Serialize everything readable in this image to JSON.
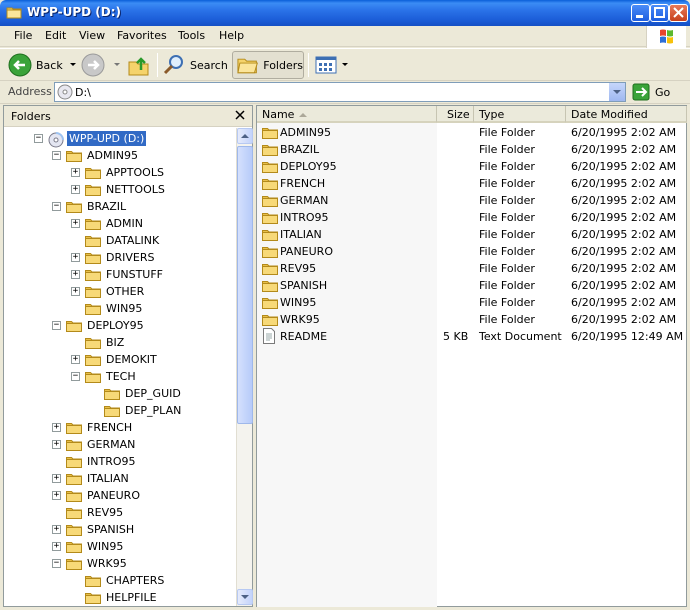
{
  "window": {
    "title": "WPP-UPD (D:)"
  },
  "menu": [
    "File",
    "Edit",
    "View",
    "Favorites",
    "Tools",
    "Help"
  ],
  "toolbar": {
    "back_label": "Back",
    "search_label": "Search",
    "folders_label": "Folders"
  },
  "address": {
    "label": "Address",
    "value": "D:\\",
    "go_label": "Go"
  },
  "folders_pane": {
    "title": "Folders",
    "tree": [
      {
        "label": "WPP-UPD (D:)",
        "level": 0,
        "expander": "-",
        "icon": "cd-drive-icon",
        "selected": true
      },
      {
        "label": "ADMIN95",
        "level": 1,
        "expander": "-"
      },
      {
        "label": "APPTOOLS",
        "level": 2,
        "expander": "+"
      },
      {
        "label": "NETTOOLS",
        "level": 2,
        "expander": "+"
      },
      {
        "label": "BRAZIL",
        "level": 1,
        "expander": "-"
      },
      {
        "label": "ADMIN",
        "level": 2,
        "expander": "+"
      },
      {
        "label": "DATALINK",
        "level": 2,
        "expander": ""
      },
      {
        "label": "DRIVERS",
        "level": 2,
        "expander": "+"
      },
      {
        "label": "FUNSTUFF",
        "level": 2,
        "expander": "+"
      },
      {
        "label": "OTHER",
        "level": 2,
        "expander": "+"
      },
      {
        "label": "WIN95",
        "level": 2,
        "expander": ""
      },
      {
        "label": "DEPLOY95",
        "level": 1,
        "expander": "-"
      },
      {
        "label": "BIZ",
        "level": 2,
        "expander": ""
      },
      {
        "label": "DEMOKIT",
        "level": 2,
        "expander": "+"
      },
      {
        "label": "TECH",
        "level": 2,
        "expander": "-"
      },
      {
        "label": "DEP_GUID",
        "level": 3,
        "expander": ""
      },
      {
        "label": "DEP_PLAN",
        "level": 3,
        "expander": ""
      },
      {
        "label": "FRENCH",
        "level": 1,
        "expander": "+"
      },
      {
        "label": "GERMAN",
        "level": 1,
        "expander": "+"
      },
      {
        "label": "INTRO95",
        "level": 1,
        "expander": ""
      },
      {
        "label": "ITALIAN",
        "level": 1,
        "expander": "+"
      },
      {
        "label": "PANEURO",
        "level": 1,
        "expander": "+"
      },
      {
        "label": "REV95",
        "level": 1,
        "expander": ""
      },
      {
        "label": "SPANISH",
        "level": 1,
        "expander": "+"
      },
      {
        "label": "WIN95",
        "level": 1,
        "expander": "+"
      },
      {
        "label": "WRK95",
        "level": 1,
        "expander": "-"
      },
      {
        "label": "CHAPTERS",
        "level": 2,
        "expander": ""
      },
      {
        "label": "HELPFILE",
        "level": 2,
        "expander": ""
      }
    ]
  },
  "file_list": {
    "columns": [
      "Name",
      "Size",
      "Type",
      "Date Modified"
    ],
    "rows": [
      {
        "name": "ADMIN95",
        "size": "",
        "type": "File Folder",
        "date": "6/20/1995 2:02 AM",
        "icon": "folder-icon"
      },
      {
        "name": "BRAZIL",
        "size": "",
        "type": "File Folder",
        "date": "6/20/1995 2:02 AM",
        "icon": "folder-icon"
      },
      {
        "name": "DEPLOY95",
        "size": "",
        "type": "File Folder",
        "date": "6/20/1995 2:02 AM",
        "icon": "folder-icon"
      },
      {
        "name": "FRENCH",
        "size": "",
        "type": "File Folder",
        "date": "6/20/1995 2:02 AM",
        "icon": "folder-icon"
      },
      {
        "name": "GERMAN",
        "size": "",
        "type": "File Folder",
        "date": "6/20/1995 2:02 AM",
        "icon": "folder-icon"
      },
      {
        "name": "INTRO95",
        "size": "",
        "type": "File Folder",
        "date": "6/20/1995 2:02 AM",
        "icon": "folder-icon"
      },
      {
        "name": "ITALIAN",
        "size": "",
        "type": "File Folder",
        "date": "6/20/1995 2:02 AM",
        "icon": "folder-icon"
      },
      {
        "name": "PANEURO",
        "size": "",
        "type": "File Folder",
        "date": "6/20/1995 2:02 AM",
        "icon": "folder-icon"
      },
      {
        "name": "REV95",
        "size": "",
        "type": "File Folder",
        "date": "6/20/1995 2:02 AM",
        "icon": "folder-icon"
      },
      {
        "name": "SPANISH",
        "size": "",
        "type": "File Folder",
        "date": "6/20/1995 2:02 AM",
        "icon": "folder-icon"
      },
      {
        "name": "WIN95",
        "size": "",
        "type": "File Folder",
        "date": "6/20/1995 2:02 AM",
        "icon": "folder-icon"
      },
      {
        "name": "WRK95",
        "size": "",
        "type": "File Folder",
        "date": "6/20/1995 2:02 AM",
        "icon": "folder-icon"
      },
      {
        "name": "README",
        "size": "5 KB",
        "type": "Text Document",
        "date": "6/20/1995 12:49 AM",
        "icon": "text-document-icon"
      }
    ]
  },
  "colors": {
    "titlebar": "#2a72e8",
    "selection": "#316ac5",
    "folder": "#f5d36b",
    "window_bg": "#ece9d8"
  }
}
